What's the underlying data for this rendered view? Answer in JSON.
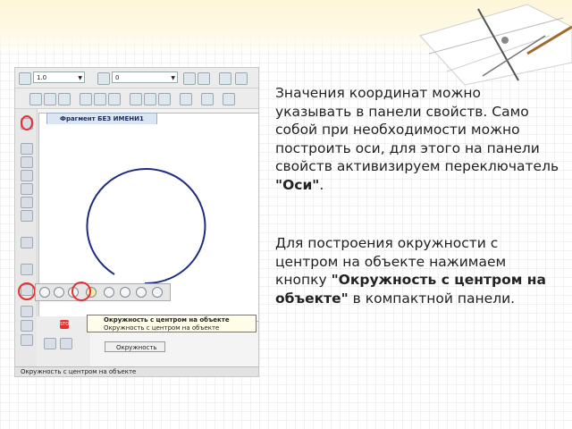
{
  "screenshot": {
    "line_width_value": "1.0",
    "layer_value": "0",
    "document_tab": "Фрагмент БЕЗ ИМЕНИ1",
    "tooltip_title": "Окружность с центром на объекте",
    "tooltip_subtitle": "Окружность с центром на объекте",
    "menu_item": "Окружность",
    "stop_label": "STOP",
    "status_text": "Окружность с центром на объекте",
    "accent_color": "#e53030",
    "circle_color": "#1f2d80"
  },
  "text": {
    "p1": "Значения координат можно указывать в панели свойств. Само собой при необходимости можно построить оси, для этого на панели свойств активизируем переключатель ",
    "p1_bold": "\"Оси\"",
    "p1_end": ".",
    "p2": "Для построения окружности с центром на объекте нажимаем кнопку ",
    "p2_bold": "\"Окружность с центром на объекте\"",
    "p2_end": " в компактной панели."
  }
}
